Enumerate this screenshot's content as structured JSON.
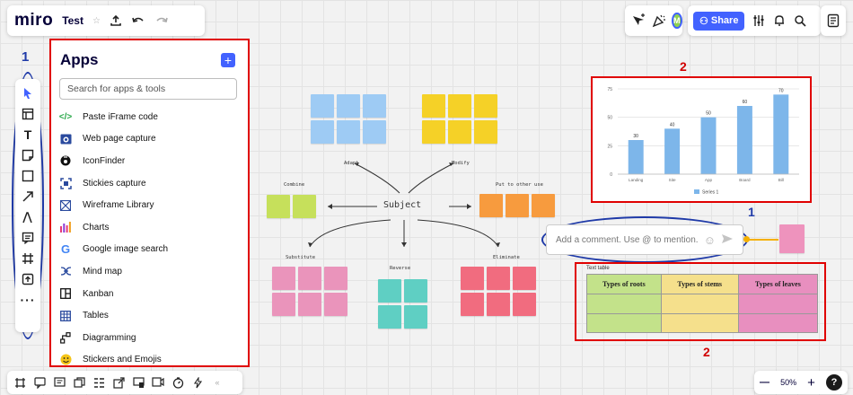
{
  "app": {
    "logo": "miro",
    "board_name": "Test",
    "share_label": "Share",
    "avatar_initial": "M"
  },
  "tools": [
    "select-icon",
    "frame-icon",
    "text-icon",
    "sticky-note-icon",
    "shape-icon",
    "arrow-icon",
    "pen-icon",
    "comment-icon",
    "crop-icon",
    "upload-icon",
    "more-icon"
  ],
  "apps_panel": {
    "title": "Apps",
    "search_placeholder": "Search for apps & tools",
    "items": [
      {
        "label": "Paste iFrame code",
        "icon": "code-icon"
      },
      {
        "label": "Web page capture",
        "icon": "webcapture-icon"
      },
      {
        "label": "IconFinder",
        "icon": "iconfinder-icon"
      },
      {
        "label": "Stickies capture",
        "icon": "stickies-capture-icon"
      },
      {
        "label": "Wireframe Library",
        "icon": "wireframe-icon"
      },
      {
        "label": "Charts",
        "icon": "charts-icon"
      },
      {
        "label": "Google image search",
        "icon": "google-icon"
      },
      {
        "label": "Mind map",
        "icon": "mindmap-icon"
      },
      {
        "label": "Kanban",
        "icon": "kanban-icon"
      },
      {
        "label": "Tables",
        "icon": "tables-icon"
      },
      {
        "label": "Diagramming",
        "icon": "diagramming-icon"
      },
      {
        "label": "Stickers and Emojis",
        "icon": "emoji-icon"
      }
    ]
  },
  "annotations": {
    "left_number": "1",
    "chart_number": "2",
    "comment_number": "1",
    "table_number": "2"
  },
  "mindmap": {
    "subject": "Subject",
    "labels": {
      "adapt": "Adapt",
      "modify": "Modify",
      "combine": "Combine",
      "other_use": "Put to other use",
      "substitute": "Substitute",
      "reverse": "Reverse",
      "eliminate": "Eliminate"
    },
    "colors": {
      "blue": "#9ecbf4",
      "yellow": "#f5d127",
      "lime": "#c6e05b",
      "orange": "#f79b3e",
      "pink": "#ea94bb",
      "teal": "#5fcfc3",
      "red": "#f16c7f",
      "pink_single": "#ee93bd"
    }
  },
  "chart_data": {
    "type": "bar",
    "categories": [
      "Landing",
      "Site",
      "App",
      "Board",
      "Bill"
    ],
    "series": [
      {
        "name": "Series 1",
        "values": [
          30,
          40,
          50,
          60,
          70
        ]
      }
    ],
    "ylim": [
      0,
      75
    ],
    "yticks": [
      0,
      25,
      50,
      75
    ],
    "grid": true,
    "legend": "bottom",
    "bar_color": "#7db6ea"
  },
  "comment": {
    "placeholder": "Add a comment. Use @ to mention."
  },
  "table": {
    "label": "Text table",
    "headers": [
      "Types of roots",
      "Types of stems",
      "Types of leaves"
    ],
    "colors": [
      "#c3e28a",
      "#f5e08c",
      "#e88fbf"
    ]
  },
  "bottom_tools": [
    "frames-icon",
    "chat-icon",
    "comments-icon",
    "cards-icon",
    "timeline-icon",
    "export-icon",
    "present-icon",
    "screen-icon",
    "timer-icon",
    "voting-icon"
  ],
  "zoom": {
    "minus": "—",
    "value": "50%",
    "plus": "+",
    "help": "?"
  }
}
